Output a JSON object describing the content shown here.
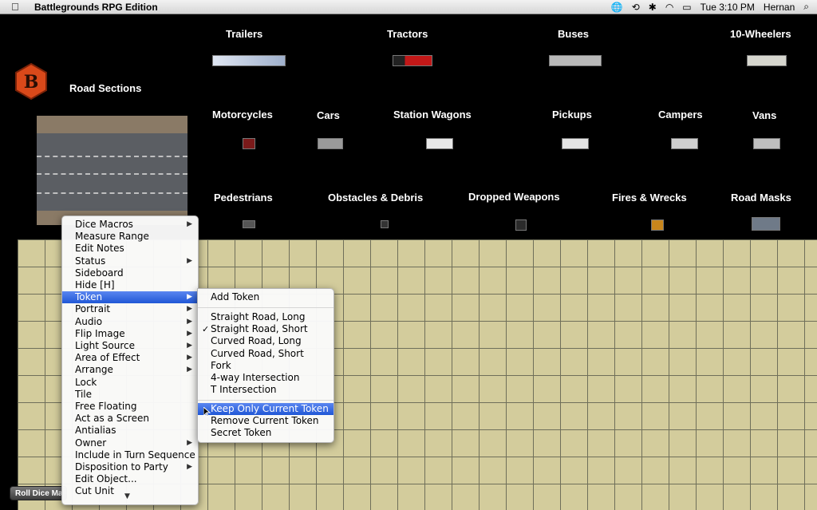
{
  "menubar": {
    "app_name": "Battlegrounds RPG Edition",
    "clock": "Tue 3:10 PM",
    "user": "Hernan"
  },
  "colors": {
    "board": "#d3cc9c",
    "grid_line": "#6f6f5a",
    "selection": "#2f66dd",
    "logo": "#e0531c"
  },
  "logo": {
    "letter": "B"
  },
  "categories": {
    "road_sections": "Road Sections",
    "trailers": "Trailers",
    "tractors": "Tractors",
    "buses": "Buses",
    "ten_wheelers": "10-Wheelers",
    "motorcycles": "Motorcycles",
    "cars": "Cars",
    "station_wagons": "Station Wagons",
    "pickups": "Pickups",
    "campers": "Campers",
    "vans": "Vans",
    "pedestrians": "Pedestrians",
    "obstacles": "Obstacles & Debris",
    "dropped_weapons": "Dropped Weapons",
    "fires_wrecks": "Fires & Wrecks",
    "road_masks": "Road Masks"
  },
  "roll_button": "Roll Dice Ma",
  "context_menu": {
    "items": [
      {
        "label": "Dice Macros",
        "submenu": true
      },
      {
        "label": "Measure Range",
        "submenu": false
      },
      {
        "label": "Edit Notes",
        "submenu": false
      },
      {
        "label": "Status",
        "submenu": true
      },
      {
        "label": "Sideboard",
        "submenu": false
      },
      {
        "label": "Hide [H]",
        "submenu": false
      },
      {
        "label": "Token",
        "submenu": true
      },
      {
        "label": "Portrait",
        "submenu": true
      },
      {
        "label": "Audio",
        "submenu": true
      },
      {
        "label": "Flip Image",
        "submenu": true
      },
      {
        "label": "Light Source",
        "submenu": true
      },
      {
        "label": "Area of Effect",
        "submenu": true
      },
      {
        "label": "Arrange",
        "submenu": true
      },
      {
        "label": "Lock",
        "submenu": false
      },
      {
        "label": "Tile",
        "submenu": false
      },
      {
        "label": "Free Floating",
        "submenu": false
      },
      {
        "label": "Act as a Screen",
        "submenu": false
      },
      {
        "label": "Antialias",
        "submenu": false
      },
      {
        "label": "Owner",
        "submenu": true
      },
      {
        "label": "Include in Turn Sequence",
        "submenu": false
      },
      {
        "label": "Disposition to Party",
        "submenu": true
      },
      {
        "label": "Edit Object...",
        "submenu": false
      },
      {
        "label": "Cut Unit",
        "submenu": false
      }
    ],
    "selected": "Token"
  },
  "token_submenu": {
    "add": "Add Token",
    "variants": [
      {
        "label": "Straight Road, Long",
        "checked": false
      },
      {
        "label": "Straight Road, Short",
        "checked": true
      },
      {
        "label": "Curved Road, Long",
        "checked": false
      },
      {
        "label": "Curved Road, Short",
        "checked": false
      },
      {
        "label": "Fork",
        "checked": false
      },
      {
        "label": "4-way Intersection",
        "checked": false
      },
      {
        "label": "T Intersection",
        "checked": false
      }
    ],
    "keep_only": "Keep Only Current Token",
    "remove": "Remove Current Token",
    "secret": "Secret Token"
  }
}
